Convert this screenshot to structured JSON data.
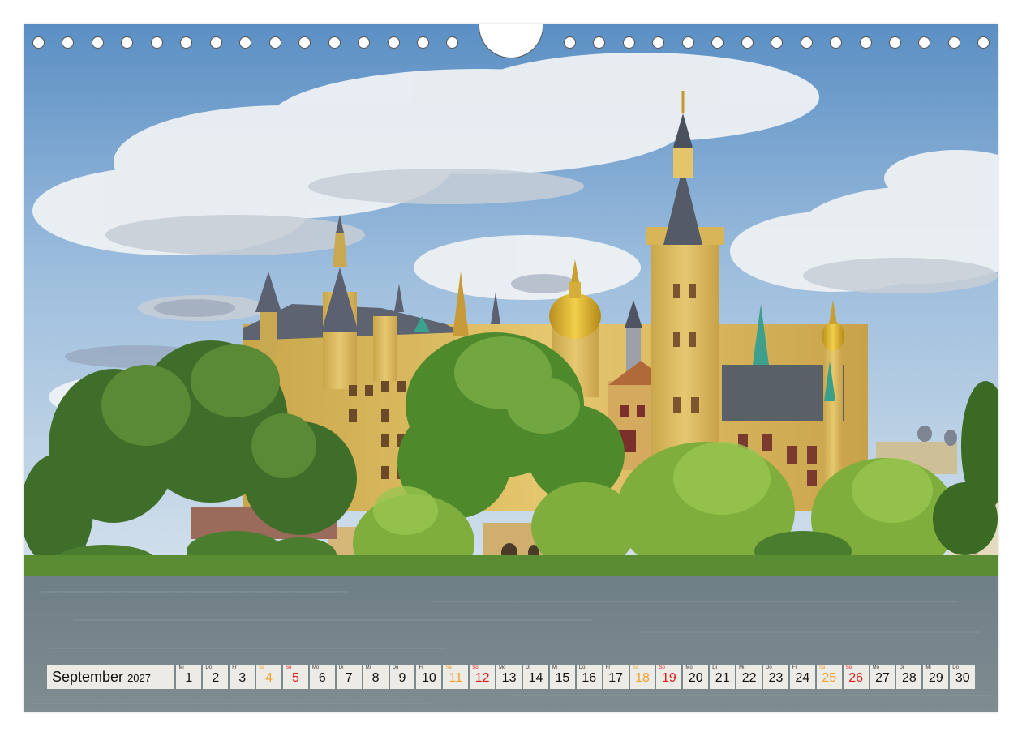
{
  "calendar": {
    "month": "September",
    "year": "2027",
    "days": [
      {
        "wd": "Mi",
        "num": "1",
        "type": "weekday"
      },
      {
        "wd": "Do",
        "num": "2",
        "type": "weekday"
      },
      {
        "wd": "Fr",
        "num": "3",
        "type": "weekday"
      },
      {
        "wd": "Sa",
        "num": "4",
        "type": "saturday"
      },
      {
        "wd": "So",
        "num": "5",
        "type": "sunday"
      },
      {
        "wd": "Mo",
        "num": "6",
        "type": "weekday"
      },
      {
        "wd": "Di",
        "num": "7",
        "type": "weekday"
      },
      {
        "wd": "Mi",
        "num": "8",
        "type": "weekday"
      },
      {
        "wd": "Do",
        "num": "9",
        "type": "weekday"
      },
      {
        "wd": "Fr",
        "num": "10",
        "type": "weekday"
      },
      {
        "wd": "Sa",
        "num": "11",
        "type": "saturday"
      },
      {
        "wd": "So",
        "num": "12",
        "type": "sunday"
      },
      {
        "wd": "Mo",
        "num": "13",
        "type": "weekday"
      },
      {
        "wd": "Di",
        "num": "14",
        "type": "weekday"
      },
      {
        "wd": "Mi",
        "num": "15",
        "type": "weekday"
      },
      {
        "wd": "Do",
        "num": "16",
        "type": "weekday"
      },
      {
        "wd": "Fr",
        "num": "17",
        "type": "weekday"
      },
      {
        "wd": "Sa",
        "num": "18",
        "type": "saturday"
      },
      {
        "wd": "So",
        "num": "19",
        "type": "sunday"
      },
      {
        "wd": "Mo",
        "num": "20",
        "type": "weekday"
      },
      {
        "wd": "Di",
        "num": "21",
        "type": "weekday"
      },
      {
        "wd": "Mi",
        "num": "22",
        "type": "weekday"
      },
      {
        "wd": "Do",
        "num": "23",
        "type": "weekday"
      },
      {
        "wd": "Fr",
        "num": "24",
        "type": "weekday"
      },
      {
        "wd": "Sa",
        "num": "25",
        "type": "saturday"
      },
      {
        "wd": "So",
        "num": "26",
        "type": "sunday"
      },
      {
        "wd": "Mo",
        "num": "27",
        "type": "weekday"
      },
      {
        "wd": "Di",
        "num": "28",
        "type": "weekday"
      },
      {
        "wd": "Mi",
        "num": "29",
        "type": "weekday"
      },
      {
        "wd": "Do",
        "num": "30",
        "type": "weekday"
      }
    ]
  },
  "colors": {
    "saturday": "#f0a030",
    "sunday": "#dd1c1c",
    "strip_background": "#ecebe6"
  },
  "photo": {
    "subject": "castle-on-lake"
  }
}
